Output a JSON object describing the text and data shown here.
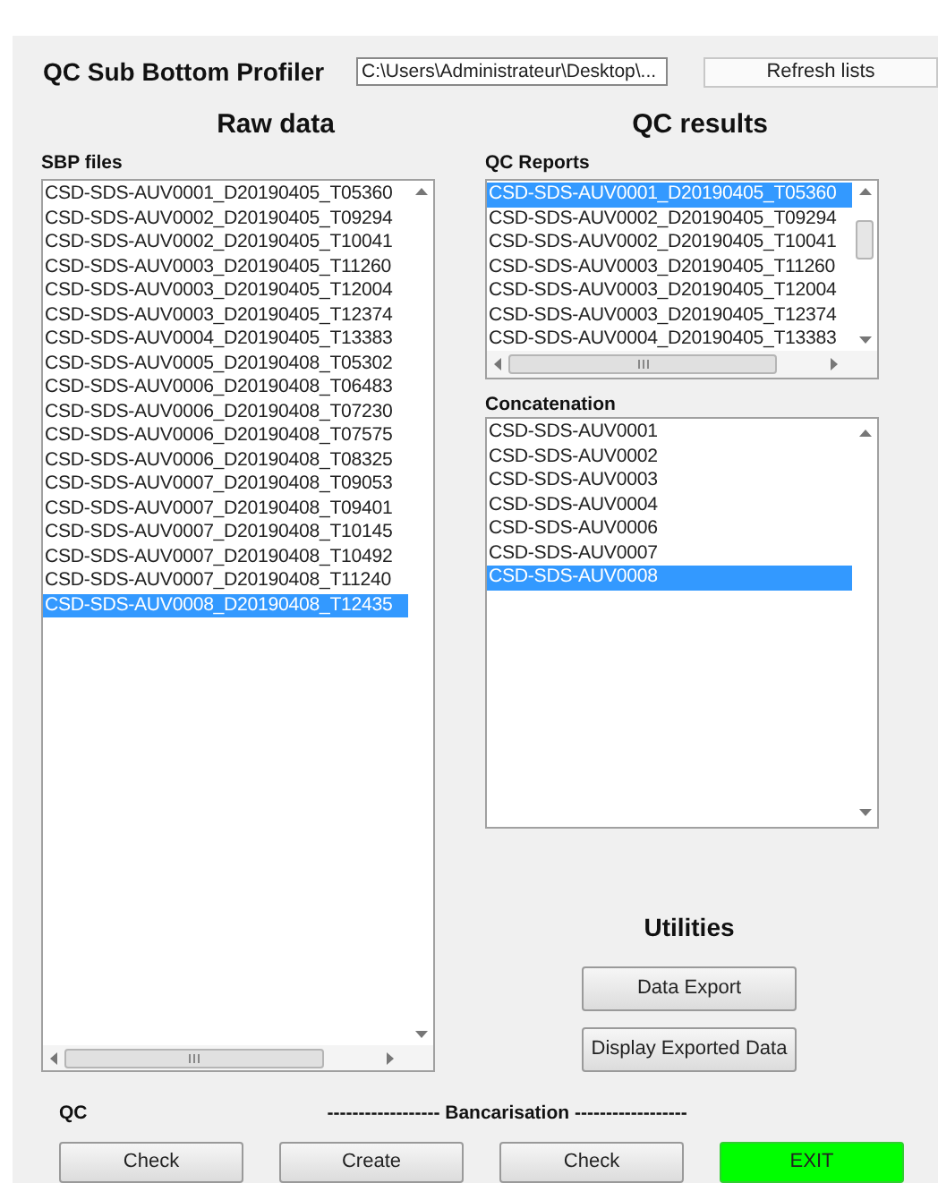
{
  "title": "QC Sub Bottom Profiler",
  "path_field": {
    "value": "C:\\Users\\Administrateur\\Desktop\\..."
  },
  "refresh_button": "Refresh lists",
  "raw_data": {
    "heading": "Raw data",
    "list_label": "SBP files",
    "files": [
      {
        "label": "CSD-SDS-AUV0001_D20190405_T05360",
        "selected": false
      },
      {
        "label": "CSD-SDS-AUV0002_D20190405_T09294",
        "selected": false
      },
      {
        "label": "CSD-SDS-AUV0002_D20190405_T10041",
        "selected": false
      },
      {
        "label": "CSD-SDS-AUV0003_D20190405_T11260",
        "selected": false
      },
      {
        "label": "CSD-SDS-AUV0003_D20190405_T12004",
        "selected": false
      },
      {
        "label": "CSD-SDS-AUV0003_D20190405_T12374",
        "selected": false
      },
      {
        "label": "CSD-SDS-AUV0004_D20190405_T13383",
        "selected": false
      },
      {
        "label": "CSD-SDS-AUV0005_D20190408_T05302",
        "selected": false
      },
      {
        "label": "CSD-SDS-AUV0006_D20190408_T06483",
        "selected": false
      },
      {
        "label": "CSD-SDS-AUV0006_D20190408_T07230",
        "selected": false
      },
      {
        "label": "CSD-SDS-AUV0006_D20190408_T07575",
        "selected": false
      },
      {
        "label": "CSD-SDS-AUV0006_D20190408_T08325",
        "selected": false
      },
      {
        "label": "CSD-SDS-AUV0007_D20190408_T09053",
        "selected": false
      },
      {
        "label": "CSD-SDS-AUV0007_D20190408_T09401",
        "selected": false
      },
      {
        "label": "CSD-SDS-AUV0007_D20190408_T10145",
        "selected": false
      },
      {
        "label": "CSD-SDS-AUV0007_D20190408_T10492",
        "selected": false
      },
      {
        "label": "CSD-SDS-AUV0007_D20190408_T11240",
        "selected": false
      },
      {
        "label": "CSD-SDS-AUV0008_D20190408_T12435",
        "selected": true
      }
    ]
  },
  "qc_results": {
    "heading": "QC results",
    "reports_label": "QC Reports",
    "reports": [
      {
        "label": "CSD-SDS-AUV0001_D20190405_T05360",
        "selected": true
      },
      {
        "label": "CSD-SDS-AUV0002_D20190405_T09294",
        "selected": false
      },
      {
        "label": "CSD-SDS-AUV0002_D20190405_T10041",
        "selected": false
      },
      {
        "label": "CSD-SDS-AUV0003_D20190405_T11260",
        "selected": false
      },
      {
        "label": "CSD-SDS-AUV0003_D20190405_T12004",
        "selected": false
      },
      {
        "label": "CSD-SDS-AUV0003_D20190405_T12374",
        "selected": false
      },
      {
        "label": "CSD-SDS-AUV0004_D20190405_T13383",
        "selected": false
      }
    ],
    "concatenation_label": "Concatenation",
    "concatenation": [
      {
        "label": "CSD-SDS-AUV0001",
        "selected": false
      },
      {
        "label": "CSD-SDS-AUV0002",
        "selected": false
      },
      {
        "label": "CSD-SDS-AUV0003",
        "selected": false
      },
      {
        "label": "CSD-SDS-AUV0004",
        "selected": false
      },
      {
        "label": "CSD-SDS-AUV0006",
        "selected": false
      },
      {
        "label": "CSD-SDS-AUV0007",
        "selected": false
      },
      {
        "label": "CSD-SDS-AUV0008",
        "selected": true
      }
    ]
  },
  "utilities": {
    "heading": "Utilities",
    "buttons": [
      "Data Export",
      "Display Exported Data"
    ]
  },
  "qc_label": "QC",
  "bancarisation_label": "------------------ Bancarisation ------------------",
  "bottom_buttons": [
    {
      "label": "Check",
      "kind": "normal"
    },
    {
      "label": "Create",
      "kind": "normal"
    },
    {
      "label": "Check",
      "kind": "normal"
    },
    {
      "label": "EXIT",
      "kind": "exit"
    }
  ]
}
